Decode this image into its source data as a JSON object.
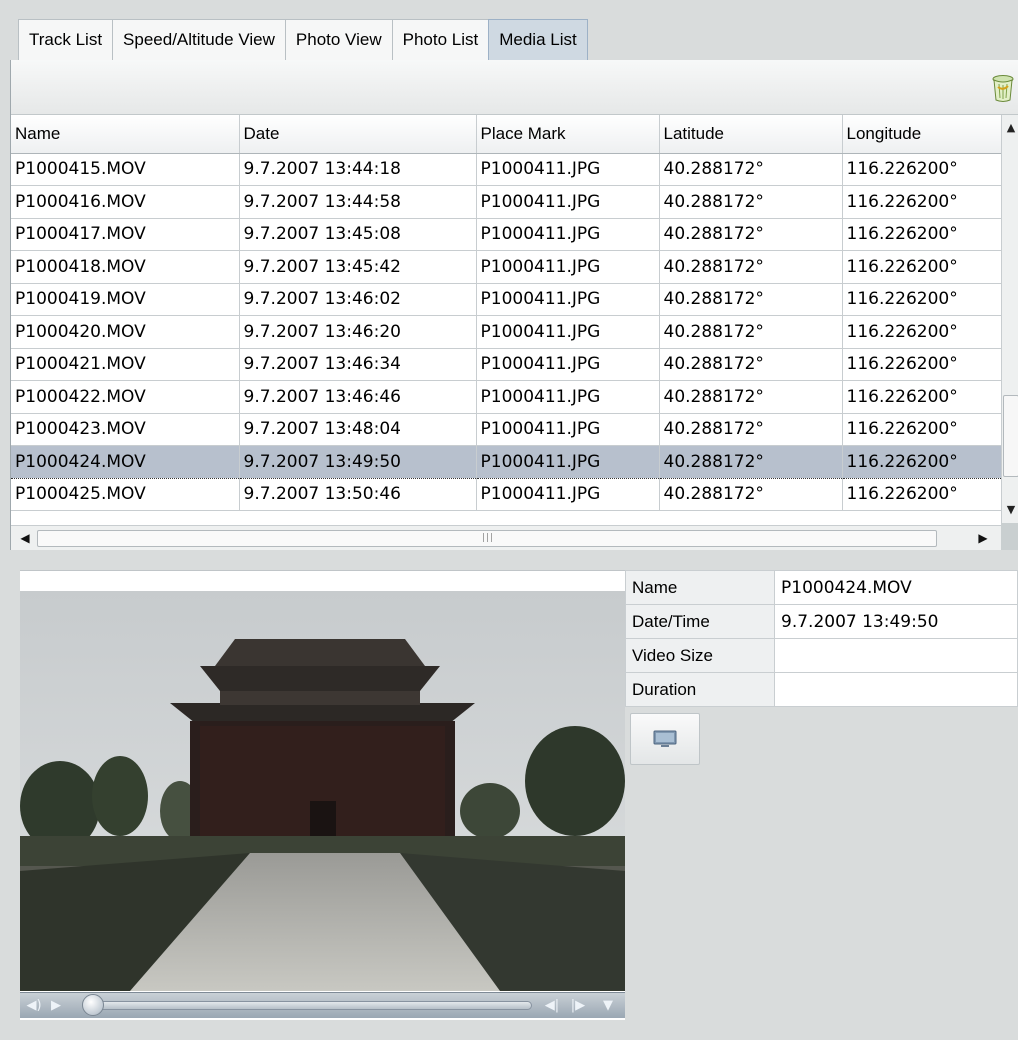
{
  "tabs": [
    {
      "label": "Track List"
    },
    {
      "label": "Speed/Altitude View"
    },
    {
      "label": "Photo View"
    },
    {
      "label": "Photo List"
    },
    {
      "label": "Media List",
      "active": true
    }
  ],
  "toolbar": {
    "delete_icon": "trash-icon"
  },
  "grid": {
    "columns": [
      "Name",
      "Date",
      "Place Mark",
      "Latitude",
      "Longitude"
    ],
    "rows": [
      [
        "P1000415.MOV",
        "9.7.2007 13:44:18",
        "P1000411.JPG",
        "40.288172°",
        "116.226200°"
      ],
      [
        "P1000416.MOV",
        "9.7.2007 13:44:58",
        "P1000411.JPG",
        "40.288172°",
        "116.226200°"
      ],
      [
        "P1000417.MOV",
        "9.7.2007 13:45:08",
        "P1000411.JPG",
        "40.288172°",
        "116.226200°"
      ],
      [
        "P1000418.MOV",
        "9.7.2007 13:45:42",
        "P1000411.JPG",
        "40.288172°",
        "116.226200°"
      ],
      [
        "P1000419.MOV",
        "9.7.2007 13:46:02",
        "P1000411.JPG",
        "40.288172°",
        "116.226200°"
      ],
      [
        "P1000420.MOV",
        "9.7.2007 13:46:20",
        "P1000411.JPG",
        "40.288172°",
        "116.226200°"
      ],
      [
        "P1000421.MOV",
        "9.7.2007 13:46:34",
        "P1000411.JPG",
        "40.288172°",
        "116.226200°"
      ],
      [
        "P1000422.MOV",
        "9.7.2007 13:46:46",
        "P1000411.JPG",
        "40.288172°",
        "116.226200°"
      ],
      [
        "P1000423.MOV",
        "9.7.2007 13:48:04",
        "P1000411.JPG",
        "40.288172°",
        "116.226200°"
      ],
      [
        "P1000424.MOV",
        "9.7.2007 13:49:50",
        "P1000411.JPG",
        "40.288172°",
        "116.226200°"
      ],
      [
        "P1000425.MOV",
        "9.7.2007 13:50:46",
        "P1000411.JPG",
        "40.288172°",
        "116.226200°"
      ]
    ],
    "selected_index": 9
  },
  "details": {
    "name_label": "Name",
    "name_value": "P1000424.MOV",
    "datetime_label": "Date/Time",
    "datetime_value": "9.7.2007 13:49:50",
    "videosize_label": "Video Size",
    "videosize_value": "",
    "duration_label": "Duration",
    "duration_value": ""
  },
  "player": {
    "seek_position": 0.0,
    "icons": [
      "volume-icon",
      "play-icon",
      "step-back-icon",
      "step-forward-icon",
      "menu-down-icon"
    ]
  },
  "colors": {
    "selected_row": "#b7c0cd",
    "active_tab": "#cfd9e2"
  }
}
